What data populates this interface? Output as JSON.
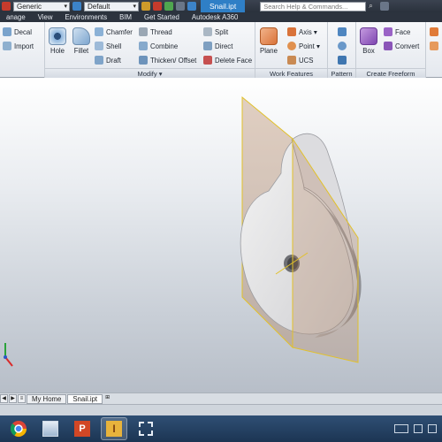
{
  "quick_access": {
    "material_value": "Generic",
    "appearance_value": "Default",
    "file_tab": "Snail.ipt",
    "search_placeholder": "Search Help & Commands..."
  },
  "ribbon_tabs": [
    {
      "label": "anage"
    },
    {
      "label": "View"
    },
    {
      "label": "Environments"
    },
    {
      "label": "BIM"
    },
    {
      "label": "Get Started"
    },
    {
      "label": "Autodesk A360"
    }
  ],
  "ribbon": {
    "create_left": {
      "decal": "Decal",
      "import": "Import"
    },
    "modify": {
      "title": "Modify ▾",
      "hole": "Hole",
      "fillet": "Fillet",
      "chamfer": "Chamfer",
      "shell": "Shell",
      "draft": "Draft",
      "thread": "Thread",
      "combine": "Combine",
      "thicken": "Thicken/ Offset",
      "split": "Split",
      "direct": "Direct",
      "delete_face": "Delete Face"
    },
    "work_features": {
      "title": "Work Features",
      "plane": "Plane",
      "axis": "Axis ▾",
      "point": "Point ▾",
      "ucs": "UCS"
    },
    "pattern": {
      "title": "Pattern"
    },
    "freeform": {
      "title": "Create Freeform",
      "box": "Box",
      "face": "Face",
      "convert": "Convert"
    }
  },
  "doc_tabs": [
    {
      "label": "My Home"
    },
    {
      "label": "Snail.ipt"
    }
  ],
  "colors": {
    "title_accent": "#2f7fc6",
    "plane_outline": "#e2c12a",
    "plane_fill": "#b07a52"
  }
}
